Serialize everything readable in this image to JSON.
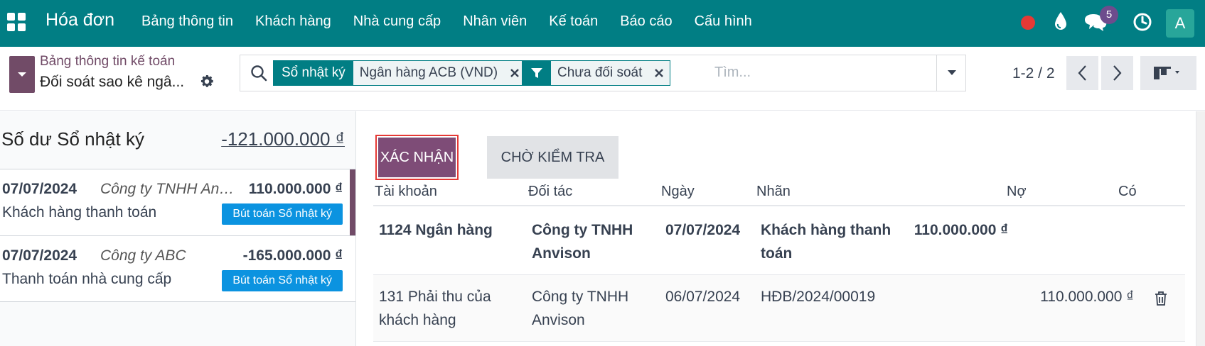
{
  "navbar": {
    "brand": "Hóa đơn",
    "menu": [
      {
        "label": "Bảng thông tin"
      },
      {
        "label": "Khách hàng"
      },
      {
        "label": "Nhà cung cấp"
      },
      {
        "label": "Nhân viên"
      },
      {
        "label": "Kế toán"
      },
      {
        "label": "Báo cáo"
      },
      {
        "label": "Cấu hình"
      }
    ],
    "chat_count": "5",
    "avatar_letter": "A",
    "colors": {
      "bar": "#017e84",
      "status_dot": "#e53935",
      "badge": "#6d4c8d",
      "avatar": "#28a69a"
    }
  },
  "control_panel": {
    "breadcrumb_parent": "Bảng thông tin kế toán",
    "breadcrumb_current": "Đối soát sao kê ngâ...",
    "search": {
      "facets": [
        {
          "type": "group",
          "label": "Sổ nhật ký",
          "value": "Ngân hàng ACB (VND)"
        },
        {
          "type": "filter",
          "label": "",
          "value": "Chưa đối soát"
        }
      ],
      "placeholder": "Tìm..."
    },
    "pager": "1-2 / 2"
  },
  "left_panel": {
    "balance_label": "Số dư Sổ nhật ký",
    "balance_value": "-121.000.000 ₫",
    "lines": [
      {
        "date": "07/07/2024",
        "partner": "Công ty TNHH Anvison",
        "amount": "110.000.000 ₫",
        "ref": "Khách hàng thanh toán",
        "badge": "Bút toán Sổ nhật ký",
        "active": true
      },
      {
        "date": "07/07/2024",
        "partner": "Công ty ABC",
        "amount": "-165.000.000 ₫",
        "ref": "Thanh toán nhà cung cấp",
        "badge": "Bút toán Sổ nhật ký",
        "active": false
      }
    ]
  },
  "right_panel": {
    "btn_validate": "XÁC NHẬN",
    "btn_to_check": "CHỜ KIỂM TRA",
    "columns": {
      "account": "Tài khoản",
      "partner": "Đối tác",
      "date": "Ngày",
      "label": "Nhãn",
      "debit": "Nợ",
      "credit": "Có"
    },
    "rows": [
      {
        "account": "1124 Ngân hàng",
        "partner": "Công ty TNHH Anvison",
        "date": "07/07/2024",
        "label": "Khách hàng thanh toán",
        "debit": "110.000.000 ₫",
        "credit": ""
      },
      {
        "account": "131 Phải thu của khách hàng",
        "partner": "Công ty TNHH Anvison",
        "date": "06/07/2024",
        "label": "HĐB/2024/00019",
        "debit": "",
        "credit": "110.000.000 ₫"
      }
    ]
  }
}
